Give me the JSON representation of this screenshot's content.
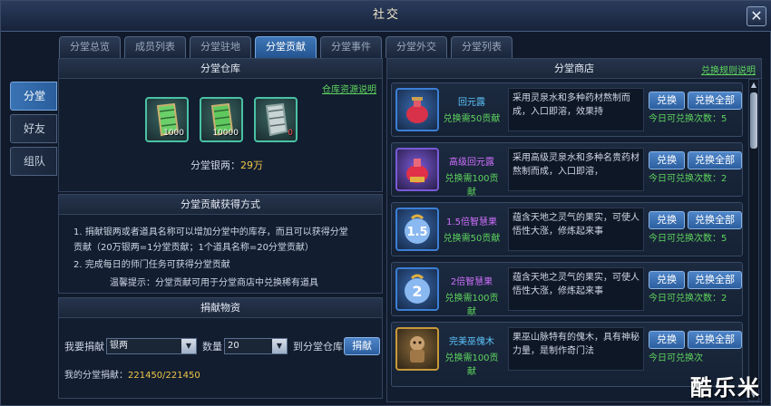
{
  "window": {
    "title": "社交"
  },
  "tabs": [
    {
      "label": "分堂总览"
    },
    {
      "label": "成员列表"
    },
    {
      "label": "分堂驻地"
    },
    {
      "label": "分堂贡献",
      "active": true
    },
    {
      "label": "分堂事件"
    },
    {
      "label": "分堂外交"
    },
    {
      "label": "分堂列表"
    }
  ],
  "side_tabs": [
    {
      "label": "分堂",
      "active": true
    },
    {
      "label": "好友"
    },
    {
      "label": "组队"
    }
  ],
  "warehouse": {
    "title": "分堂仓库",
    "help_link": "仓库资源说明",
    "items": [
      {
        "icon": "green-scroll-icon",
        "qty": "1000"
      },
      {
        "icon": "green-scroll-icon",
        "qty": "10000"
      },
      {
        "icon": "silver-scroll-icon",
        "qty": "0"
      }
    ],
    "silver_label": "分堂银两：",
    "silver_value": "29万"
  },
  "contribution": {
    "title": "分堂贡献获得方式",
    "line1": "1. 捐献银两或者道具名称可以增加分堂中的库存，而且可以获得分堂",
    "line2": "贡献（20万银两=1分堂贡献；1个道具名称=20分堂贡献）",
    "line3": "2. 完成每日的师门任务可获得分堂贡献",
    "tip": "温馨提示：分堂贡献可用于分堂商店中兑换稀有道具"
  },
  "donate": {
    "title": "捐献物资",
    "donate_label": "我要捐献",
    "donate_value": "银两",
    "qty_label": "数量",
    "qty_value": "20",
    "to_label": "到分堂仓库",
    "button": "捐献",
    "my_label": "我的分堂捐献：",
    "my_value": "221450/221450"
  },
  "shop": {
    "title": "分堂商店",
    "rules_link": "兑换规则说明",
    "items": [
      {
        "name": "回元露",
        "cost": "兑换需50贡献",
        "desc": "采用灵泉水和多种药材熬制而成，入口即溶，效果持",
        "count": "今日可兑换次数：5",
        "icon": "red-potion-icon",
        "btn1": "兑换",
        "btn2": "兑换全部"
      },
      {
        "name": "高级回元露",
        "cost": "兑换需100贡献",
        "desc": "采用高级灵泉水和多种名贵药材熬制而成，入口即溶，",
        "count": "今日可兑换次数：2",
        "icon": "red-potion-icon",
        "btn1": "兑换",
        "btn2": "兑换全部"
      },
      {
        "name": "1.5倍智慧果",
        "cost": "兑换需50贡献",
        "desc": "蕴含天地之灵气的果实，可使人悟性大涨，修炼起来事",
        "count": "今日可兑换次数：5",
        "icon": "fruit-1-5-icon",
        "btn1": "兑换",
        "btn2": "兑换全部"
      },
      {
        "name": "2倍智慧果",
        "cost": "兑换需100贡献",
        "desc": "蕴含天地之灵气的果实，可使人悟性大涨，修炼起来事",
        "count": "今日可兑换次数：2",
        "icon": "fruit-2-icon",
        "btn1": "兑换",
        "btn2": "兑换全部"
      },
      {
        "name": "完美巫傀木",
        "cost": "兑换需100贡献",
        "desc": "果巫山脉特有的傀木，具有神秘力量，是制作奇门法",
        "count": "今日可兑换次",
        "icon": "puppet-icon",
        "btn1": "兑换",
        "btn2": "兑换全部"
      }
    ]
  },
  "watermark": "酷乐米"
}
